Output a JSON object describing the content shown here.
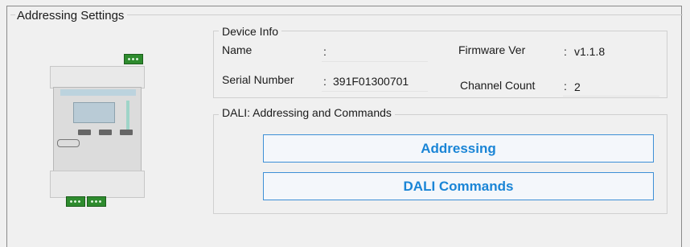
{
  "window": {
    "title": "Addressing Settings"
  },
  "device_info": {
    "title": "Device Info",
    "name_label": "Name",
    "name_sep": ":",
    "name_value": "",
    "serial_label": "Serial Number",
    "serial_sep": ":",
    "serial_value": "391F01300701",
    "firmware_label": "Firmware Ver",
    "firmware_sep": ":",
    "firmware_value": "v1.1.8",
    "channel_label": "Channel Count",
    "channel_sep": ":",
    "channel_value": "2"
  },
  "dali": {
    "title": "DALI: Addressing and Commands",
    "addressing_button": "Addressing",
    "commands_button": "DALI Commands"
  },
  "colors": {
    "accent": "#1a85d6",
    "button_border": "#3d8fd6",
    "terminal": "#2e8b2e"
  },
  "image": {
    "icon": "dali-controller-device-image"
  }
}
